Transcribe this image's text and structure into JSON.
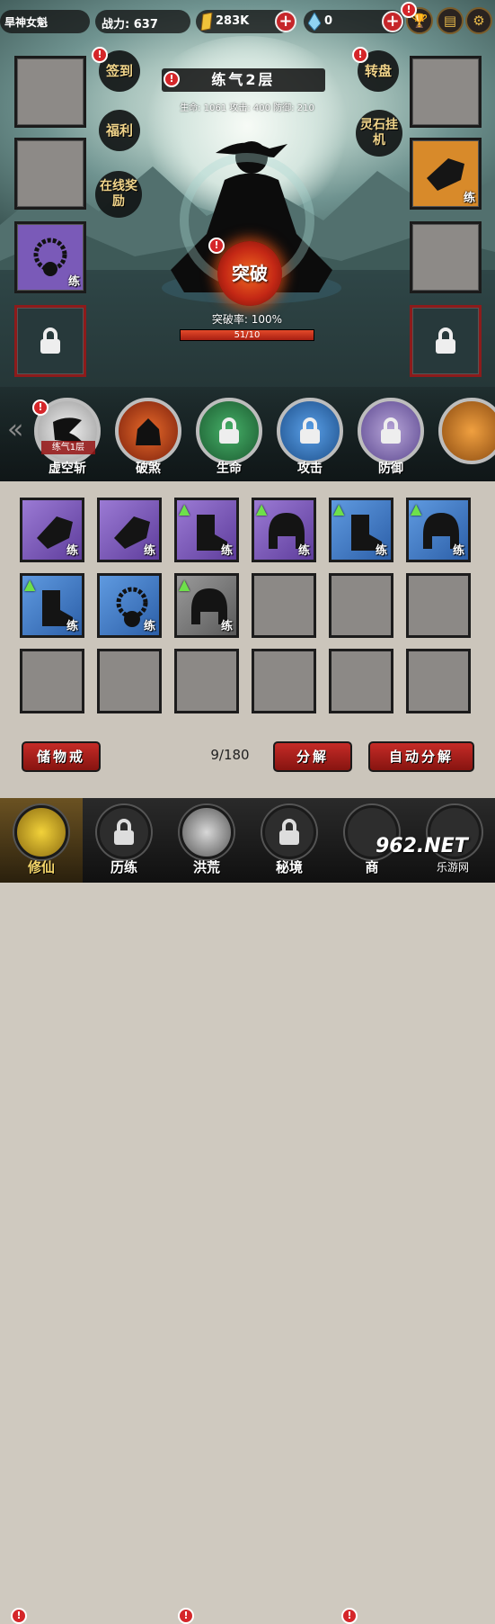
{
  "top_bar": {
    "player_name": "旱神女魁",
    "power_label": "战力: 637",
    "gold": "283K",
    "gems": "0",
    "plus_symbol": "+"
  },
  "realm": {
    "title": "练气2层",
    "stats": "生命: 1061  攻击: 400  防御: 210",
    "break_button": "突破",
    "break_rate": "突破率: 100%",
    "progress_text": "51/10",
    "progress_fraction": 1.0
  },
  "left_buttons": {
    "checkin": "签到",
    "welfare": "福利",
    "online_reward": "在线奖励"
  },
  "right_buttons": {
    "wheel": "转盘",
    "afk": "灵石挂机"
  },
  "equip_labels": {
    "refine": "练"
  },
  "skills": [
    {
      "label": "虚空斩",
      "sublabel": "练气1层"
    },
    {
      "label": "破煞"
    },
    {
      "label": "生命"
    },
    {
      "label": "攻击"
    },
    {
      "label": "防御"
    }
  ],
  "inventory": {
    "capacity": "9/180",
    "storage_button": "储物戒",
    "decompose_button": "分解",
    "auto_decompose_button": "自动分解",
    "items": [
      {
        "rarity": "purple",
        "icon": "gauntlet-icon",
        "label": "练",
        "upgrade": false
      },
      {
        "rarity": "purple",
        "icon": "gauntlet-icon",
        "label": "练",
        "upgrade": false
      },
      {
        "rarity": "purple",
        "icon": "boots-icon",
        "label": "练",
        "upgrade": true
      },
      {
        "rarity": "purple",
        "icon": "helmet-icon",
        "label": "练",
        "upgrade": true
      },
      {
        "rarity": "blue",
        "icon": "boots-icon",
        "label": "练",
        "upgrade": true
      },
      {
        "rarity": "blue",
        "icon": "helmet-icon",
        "label": "练",
        "upgrade": true
      },
      {
        "rarity": "blue",
        "icon": "boots-icon",
        "label": "练",
        "upgrade": true
      },
      {
        "rarity": "blue",
        "icon": "bead-necklace-icon",
        "label": "练",
        "upgrade": false
      },
      {
        "rarity": "gray",
        "icon": "helmet-icon",
        "label": "练",
        "upgrade": true
      }
    ]
  },
  "nav": [
    {
      "label": "修仙",
      "active": true
    },
    {
      "label": "历练"
    },
    {
      "label": "洪荒"
    },
    {
      "label": "秘境"
    },
    {
      "label": "商"
    }
  ],
  "watermark": {
    "brand": "962.NET",
    "sub": "乐游网"
  },
  "colors": {
    "accent_red": "#c52b27",
    "gold": "#e6b84a",
    "purple": "#7a5ab8",
    "blue": "#3f7bc8",
    "orange": "#d88a2a"
  }
}
